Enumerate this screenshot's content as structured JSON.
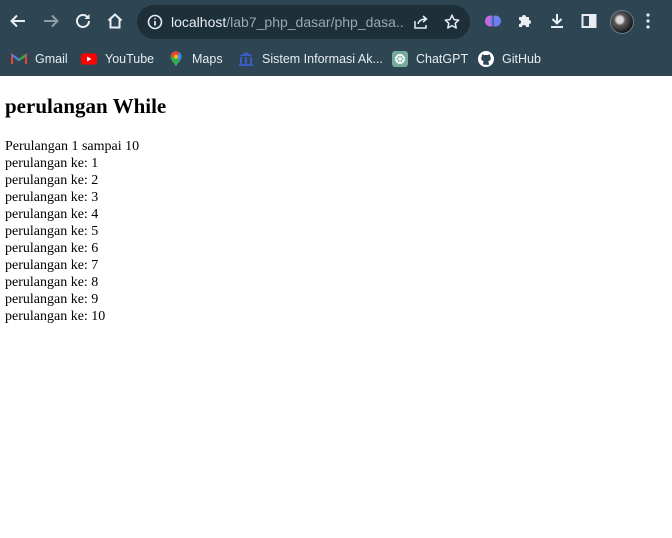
{
  "browser": {
    "url_host": "localhost",
    "url_path": "/lab7_php_dasar/php_dasa...",
    "bookmarks": [
      {
        "label": "Gmail",
        "icon": "gmail-icon"
      },
      {
        "label": "YouTube",
        "icon": "youtube-icon"
      },
      {
        "label": "Maps",
        "icon": "maps-icon"
      },
      {
        "label": "Sistem Informasi Ak...",
        "icon": "university-icon"
      },
      {
        "label": "ChatGPT",
        "icon": "chatgpt-icon"
      },
      {
        "label": "GitHub",
        "icon": "github-icon"
      }
    ],
    "colors": {
      "chrome": "#2e4653",
      "omnibox": "#1d2f39"
    }
  },
  "page": {
    "heading": "perulangan While",
    "intro": "Perulangan 1 sampai 10",
    "lines": [
      "perulangan ke: 1",
      "perulangan ke: 2",
      "perulangan ke: 3",
      "perulangan ke: 4",
      "perulangan ke: 5",
      "perulangan ke: 6",
      "perulangan ke: 7",
      "perulangan ke: 8",
      "perulangan ke: 9",
      "perulangan ke: 10"
    ]
  }
}
